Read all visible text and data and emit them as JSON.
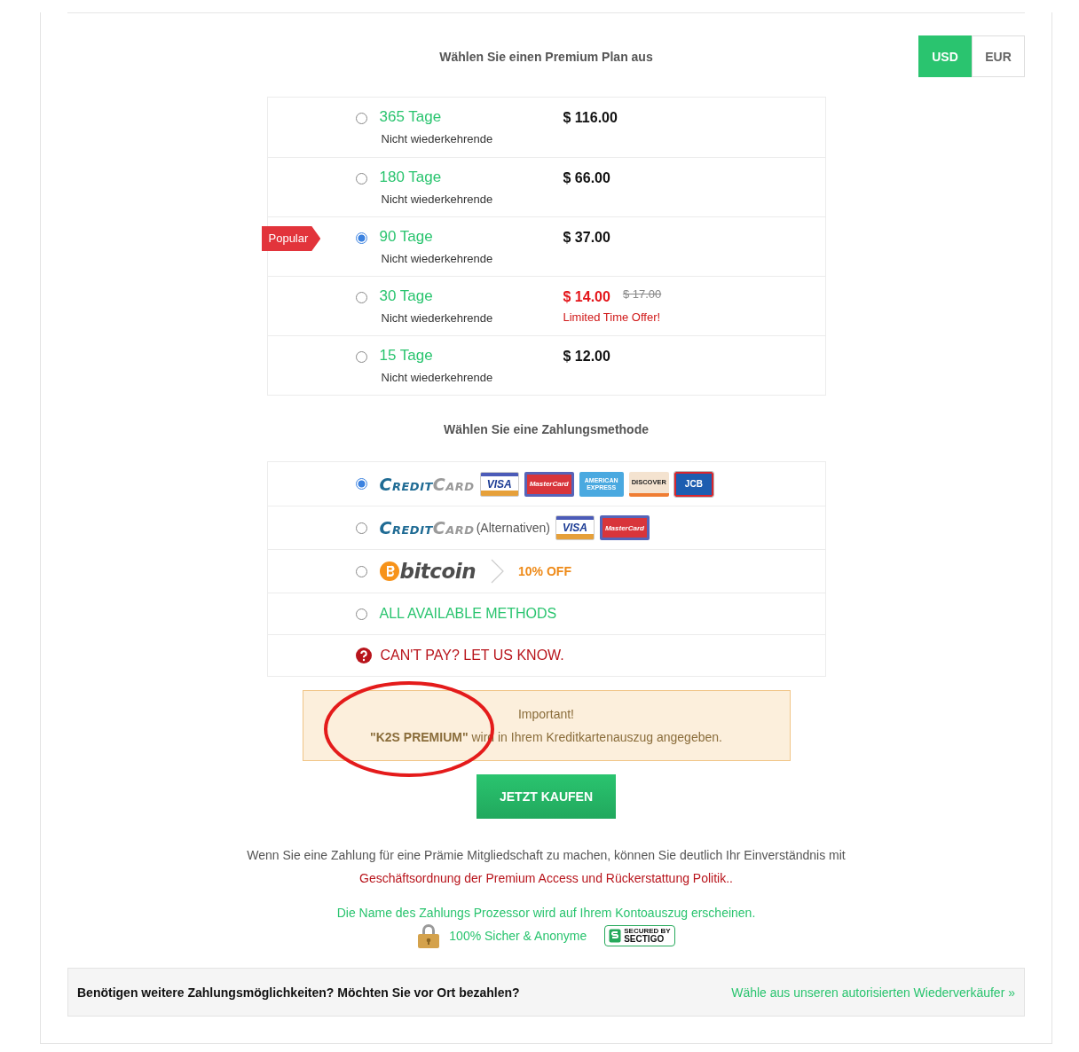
{
  "heading": "Wählen Sie einen Premium Plan aus",
  "currencies": [
    {
      "label": "USD",
      "selected": true
    },
    {
      "label": "EUR",
      "selected": false
    }
  ],
  "plans": [
    {
      "duration": "365 Tage",
      "note": "Nicht wiederkehrende",
      "price": "$ 116.00",
      "selected": false
    },
    {
      "duration": "180 Tage",
      "note": "Nicht wiederkehrende",
      "price": "$ 66.00",
      "selected": false
    },
    {
      "duration": "90 Tage",
      "note": "Nicht wiederkehrende",
      "price": "$ 37.00",
      "selected": true,
      "badge": "Popular"
    },
    {
      "duration": "30 Tage",
      "note": "Nicht wiederkehrende",
      "price": "$ 14.00",
      "selected": false,
      "old_price": "$ 17.00",
      "offer": "Limited Time Offer!"
    },
    {
      "duration": "15 Tage",
      "note": "Nicht wiederkehrende",
      "price": "$ 12.00",
      "selected": false
    }
  ],
  "payment_heading": "Wählen Sie eine Zahlungsmethode",
  "methods": [
    {
      "kind": "card",
      "selected": true,
      "brand_first": "Credit",
      "brand_second": "Card",
      "logos": [
        {
          "kind": "visa",
          "label": "VISA"
        },
        {
          "kind": "mastercard",
          "label": "MasterCard"
        },
        {
          "kind": "amex",
          "label": "AMERICAN EXPRESS"
        },
        {
          "kind": "discover",
          "label": "DISCOVER"
        },
        {
          "kind": "jcb",
          "label": "JCB"
        }
      ]
    },
    {
      "kind": "card",
      "selected": false,
      "brand_first": "Credit",
      "brand_second": "Card",
      "note": "(Alternativen)",
      "logos": [
        {
          "kind": "visa",
          "label": "VISA"
        },
        {
          "kind": "mastercard",
          "label": "MasterCard"
        }
      ]
    },
    {
      "kind": "crypto",
      "selected": false,
      "label": "bitcoin",
      "discount": "10% OFF"
    },
    {
      "kind": "text",
      "selected": false,
      "label": "ALL AVAILABLE METHODS"
    },
    {
      "kind": "help",
      "label": "CAN'T PAY? LET US KNOW."
    }
  ],
  "notice": {
    "title": "Important!",
    "text": "**\"K2S PREMIUM\"** wird in Ihrem Kreditkartenauszug angegeben."
  },
  "buy_button": "JETZT KAUFEN",
  "consent": {
    "text": "Wenn Sie eine Zahlung für eine Prämie Mitgliedschaft zu machen, können Sie deutlich Ihr Einverständnis mit",
    "link": "Geschäftsordnung der Premium Access und Rückerstattung Politik.."
  },
  "processor_note": "Die Name des Zahlungs Prozessor wird auf Ihrem Kontoauszug erscheinen.",
  "secure_label": "100% Sicher & Anonyme",
  "seal": {
    "top": "SECURED BY",
    "bottom": "SECTIGO"
  },
  "footer": {
    "question": "Benötigen weitere Zahlungsmöglichkeiten? Möchten Sie vor Ort bezahlen?",
    "link": "Wähle aus unseren autorisierten Wiederverkäufer »"
  }
}
